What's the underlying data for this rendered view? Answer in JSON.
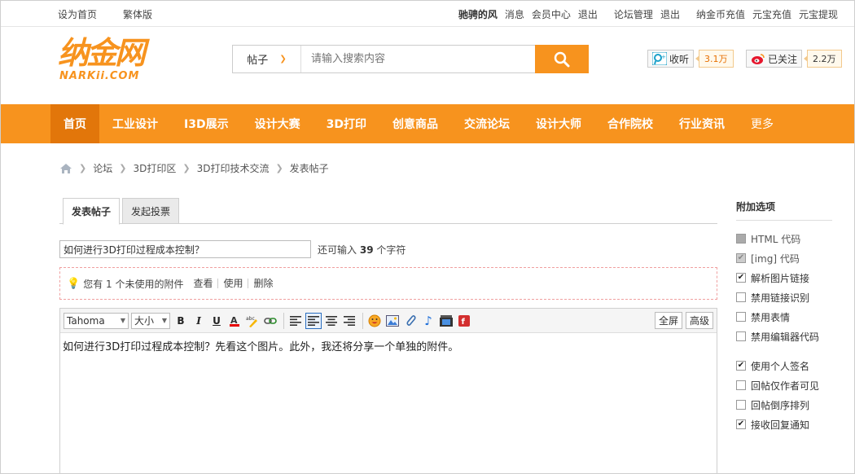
{
  "topbar": {
    "left": [
      "设为首页",
      "繁体版"
    ],
    "user": "驰骋的风",
    "links_a": [
      "消息",
      "会员中心",
      "退出"
    ],
    "links_b": [
      "论坛管理",
      "退出"
    ],
    "links_c": [
      "纳金币充值",
      "元宝充值",
      "元宝提现"
    ]
  },
  "logo": {
    "cn": "纳金网",
    "en": "NARKii.COM"
  },
  "search": {
    "type": "帖子",
    "placeholder": "请输入搜索内容"
  },
  "social": {
    "listen_label": "收听",
    "listen_count": "3.1万",
    "follow_label": "已关注",
    "follow_count": "2.2万"
  },
  "nav": [
    "首页",
    "工业设计",
    "I3D展示",
    "设计大赛",
    "3D打印",
    "创意商品",
    "交流论坛",
    "设计大师",
    "合作院校",
    "行业资讯",
    "更多"
  ],
  "breadcrumb": [
    "论坛",
    "3D打印区",
    "3D打印技术交流",
    "发表帖子"
  ],
  "tabs": [
    "发表帖子",
    "发起投票"
  ],
  "post": {
    "title": "如何进行3D打印过程成本控制？",
    "hint_prefix": "还可输入",
    "hint_count": "39",
    "hint_suffix": "个字符",
    "content": "如何进行3D打印过程成本控制？先看这个图片。此外，我还将分享一个单独的附件。"
  },
  "attach": {
    "text": "您有 1 个未使用的附件",
    "view": "查看",
    "use": "使用",
    "delete": "删除"
  },
  "editor": {
    "font": "Tahoma",
    "size": "大小",
    "fullscreen": "全屏",
    "advanced": "高级"
  },
  "side": {
    "title": "附加选项",
    "group1": [
      {
        "label": "HTML 代码",
        "checked": false,
        "disabled": true
      },
      {
        "label": "[img] 代码",
        "checked": true,
        "disabled": true
      },
      {
        "label": "解析图片链接",
        "checked": true,
        "disabled": false
      },
      {
        "label": "禁用链接识别",
        "checked": false,
        "disabled": false
      },
      {
        "label": "禁用表情",
        "checked": false,
        "disabled": false
      },
      {
        "label": "禁用编辑器代码",
        "checked": false,
        "disabled": false
      }
    ],
    "group2": [
      {
        "label": "使用个人签名",
        "checked": true,
        "disabled": false
      },
      {
        "label": "回帖仅作者可见",
        "checked": false,
        "disabled": false
      },
      {
        "label": "回帖倒序排列",
        "checked": false,
        "disabled": false
      },
      {
        "label": "接收回复通知",
        "checked": true,
        "disabled": false
      }
    ]
  },
  "colors": {
    "accent": "#f7931e",
    "nav_active": "#e2760a"
  }
}
